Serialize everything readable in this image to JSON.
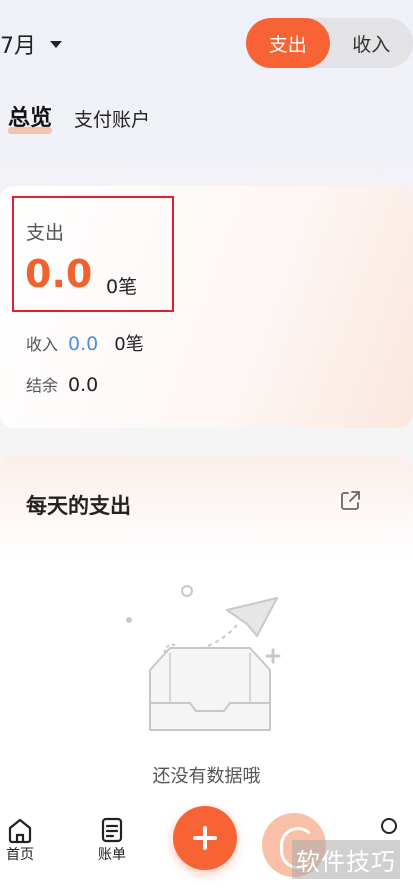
{
  "header": {
    "month_label": "7月",
    "toggle_expense": "支出",
    "toggle_income": "收入"
  },
  "tabs": {
    "overview": "总览",
    "payment_account": "支付账户"
  },
  "overview_card": {
    "expense_label": "支出",
    "expense_value": "0.0",
    "expense_count": "0笔",
    "income_label": "收入",
    "income_value": "0.0",
    "income_count": "0笔",
    "balance_label": "结余",
    "balance_value": "0.0"
  },
  "daily_card": {
    "title": "每天的支出",
    "empty_text": "还没有数据哦"
  },
  "bottom_nav": {
    "home_label": "首页",
    "bills_label": "账单"
  },
  "watermark_text": "软件技巧",
  "colors": {
    "accent": "#f76335",
    "income_blue": "#4a90e2",
    "highlight_red": "#e0202a"
  }
}
